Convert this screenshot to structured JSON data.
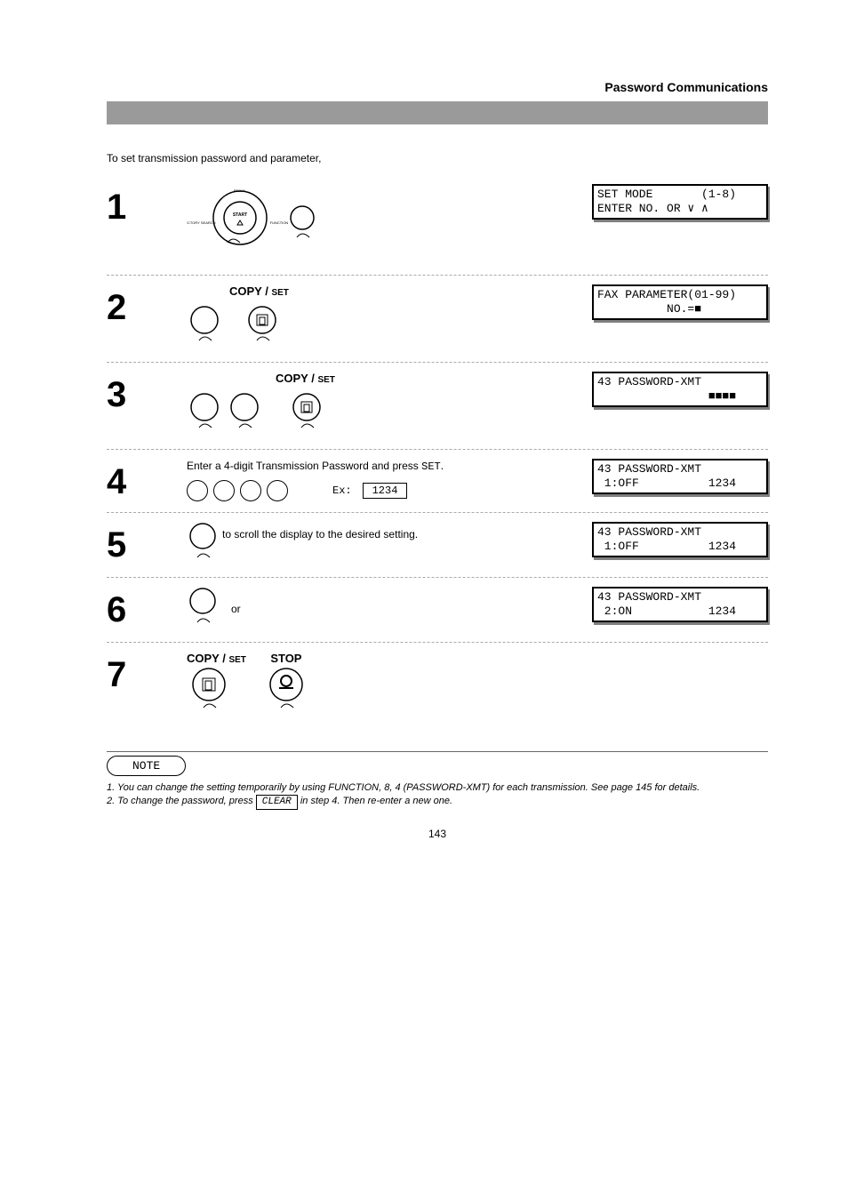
{
  "header": {
    "top_right": "Password Communications",
    "bar_text": ""
  },
  "intro": "To set transmission password and parameter,",
  "steps": [
    {
      "num": "1",
      "lcds": [
        {
          "line1": "SET MODE       (1-8)",
          "line2": "ENTER NO. OR ∨ ∧"
        }
      ]
    },
    {
      "num": "2",
      "label": "COPY / SET",
      "lcds": [
        {
          "line1": "FAX PARAMETER(01-99)",
          "line2": "          NO.=■"
        }
      ]
    },
    {
      "num": "3",
      "label": "COPY / SET",
      "lcds": [
        {
          "line1": "43 PASSWORD-XMT",
          "line2": "                ■■■■"
        }
      ]
    },
    {
      "num": "4",
      "text": "Enter a 4-digit Transmission Password and press SET.\n\nEx:",
      "ex": "1234",
      "lcds": [
        {
          "line1": "43 PASSWORD-XMT",
          "line2": " 1:OFF          1234"
        }
      ]
    },
    {
      "num": "5",
      "text": "  to scroll the display to the desired setting.",
      "lcds": [
        {
          "line1": "43 PASSWORD-XMT",
          "line2": " 1:OFF          1234"
        }
      ]
    },
    {
      "num": "6",
      "or": "or",
      "lcds": [
        {
          "line1": "43 PASSWORD-XMT",
          "line2": " 2:ON           1234"
        }
      ]
    },
    {
      "num": "7",
      "label1": "COPY / SET",
      "label2": "STOP"
    }
  ],
  "note": {
    "title": "NOTE",
    "body": "1. You can change the setting temporarily by using FUNCTION, 8, 4 (PASSWORD-XMT) for each transmission. See page 145 for details.\n2. To change the password, press CLEAR in step 4. Then re-enter a new one.",
    "clear_key": "CLEAR"
  },
  "footer": {
    "page": "143"
  }
}
